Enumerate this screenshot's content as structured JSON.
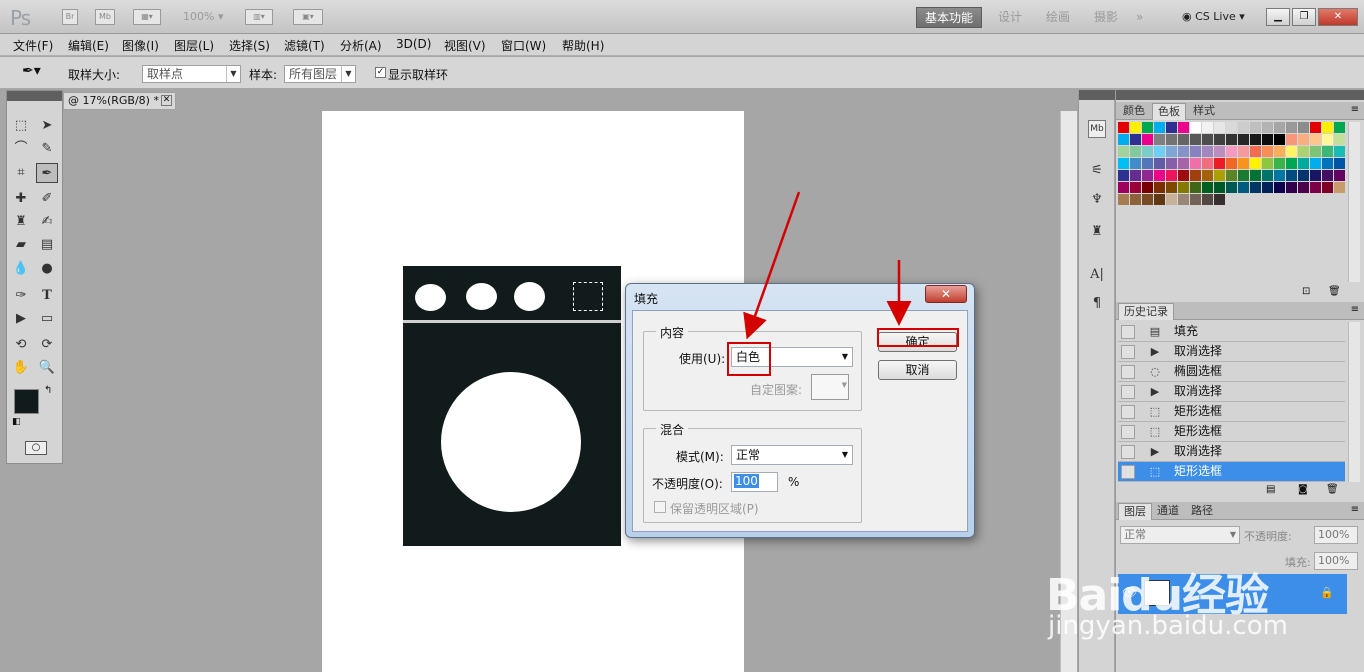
{
  "app": {
    "logo": "Ps",
    "zoom": "100%",
    "cs_live": "CS Live"
  },
  "workspaces": [
    "基本功能",
    "设计",
    "绘画",
    "摄影"
  ],
  "menu": [
    "文件(F)",
    "编辑(E)",
    "图像(I)",
    "图层(L)",
    "选择(S)",
    "滤镜(T)",
    "分析(A)",
    "3D(D)",
    "视图(V)",
    "窗口(W)",
    "帮助(H)"
  ],
  "options": {
    "sample_size_label": "取样大小:",
    "sample_size_value": "取样点",
    "sample_label": "样本:",
    "sample_value": "所有图层",
    "show_ring_label": "显示取样环"
  },
  "document": {
    "tab_title": "@ 17%(RGB/8) *"
  },
  "panels": {
    "swatch_tabs": [
      "颜色",
      "色板",
      "样式"
    ],
    "history_tab": "历史记录",
    "history": [
      {
        "label": "填充",
        "icon": "fill"
      },
      {
        "label": "取消选择",
        "icon": "deselect"
      },
      {
        "label": "椭圆选框",
        "icon": "ellipse"
      },
      {
        "label": "取消选择",
        "icon": "deselect"
      },
      {
        "label": "矩形选框",
        "icon": "rect"
      },
      {
        "label": "矩形选框",
        "icon": "rect"
      },
      {
        "label": "取消选择",
        "icon": "deselect"
      },
      {
        "label": "矩形选框",
        "icon": "rect"
      }
    ],
    "layer_tabs": [
      "图层",
      "通道",
      "路径"
    ],
    "blend_mode": "正常",
    "opacity_label": "不透明度:",
    "opacity_value": "100%",
    "fill_label": "填充:",
    "fill_value": "100%"
  },
  "dialog": {
    "title": "填充",
    "content_group": "内容",
    "use_label": "使用(U):",
    "use_value": "白色",
    "custom_pattern_label": "自定图案:",
    "blend_group": "混合",
    "mode_label": "模式(M):",
    "mode_value": "正常",
    "opacity_label": "不透明度(O):",
    "opacity_value": "100",
    "percent": "%",
    "preserve_label": "保留透明区域(P)",
    "ok": "确定",
    "cancel": "取消"
  },
  "watermark": {
    "logo": "Baidu经验",
    "url": "jingyan.baidu.com"
  },
  "colors": {
    "washer": "#121b1b",
    "highlight": "#3d8ee8",
    "annotation": "#d40000"
  }
}
